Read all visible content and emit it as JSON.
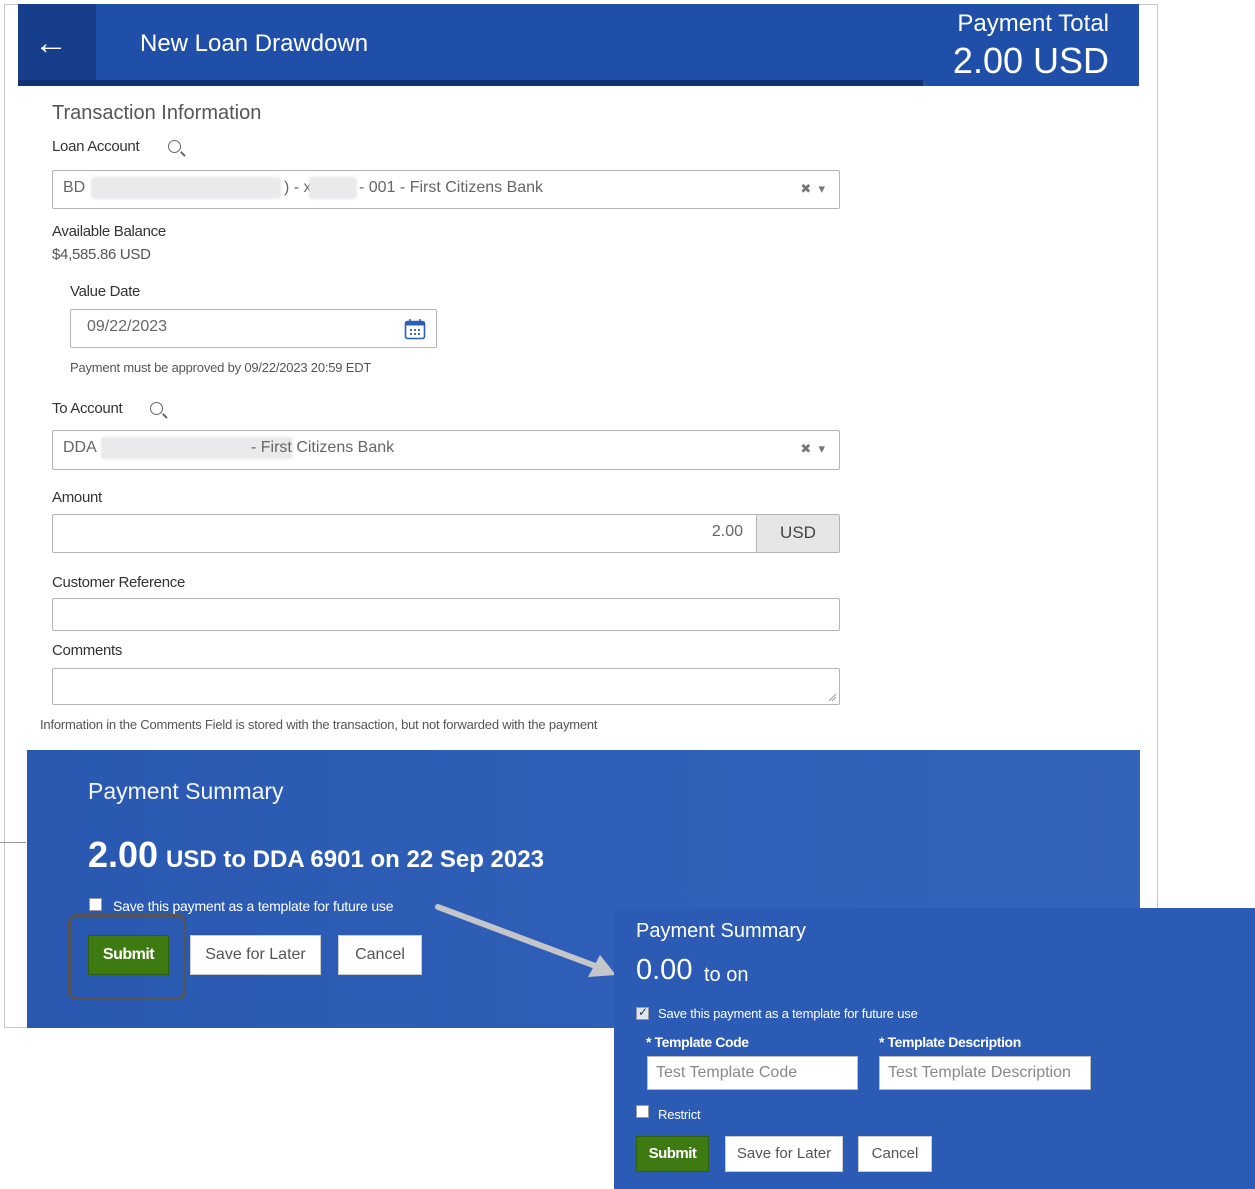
{
  "header": {
    "title": "New Loan Drawdown",
    "payment_total_label": "Payment Total",
    "payment_total_value": "2.00 USD"
  },
  "form": {
    "section_title": "Transaction Information",
    "loan_account": {
      "label": "Loan Account",
      "prefix": "BD",
      "mid": ") - x",
      "suffix": "- 001 - First Citizens Bank"
    },
    "available_balance": {
      "label": "Available Balance",
      "value": "$4,585.86 USD"
    },
    "value_date": {
      "label": "Value Date",
      "value": "09/22/2023",
      "note": "Payment must be approved by 09/22/2023 20:59 EDT"
    },
    "to_account": {
      "label": "To Account",
      "prefix": "DDA",
      "suffix": "- First Citizens Bank"
    },
    "amount": {
      "label": "Amount",
      "value": "2.00",
      "currency": "USD"
    },
    "customer_reference": {
      "label": "Customer Reference",
      "value": ""
    },
    "comments": {
      "label": "Comments",
      "value": "",
      "note": "Information in the Comments Field is stored with the transaction, but not forwarded with the payment"
    }
  },
  "summary": {
    "title": "Payment Summary",
    "amount": "2.00",
    "rest": "USD to DDA 6901 on 22 Sep 2023",
    "save_template_label": "Save this payment as a template for future use",
    "buttons": {
      "submit": "Submit",
      "save_later": "Save for Later",
      "cancel": "Cancel"
    }
  },
  "inset": {
    "title": "Payment Summary",
    "amount": "0.00",
    "rest": "to on",
    "save_template_label": "Save this payment as a template for future use",
    "template_code_label": "* Template Code",
    "template_code_value": "Test Template Code",
    "template_desc_label": "* Template Description",
    "template_desc_value": "Test Template Description",
    "restrict_label": "Restrict",
    "buttons": {
      "submit": "Submit",
      "save_later": "Save for Later",
      "cancel": "Cancel"
    }
  },
  "colors": {
    "header_blue": "#1f4fa8",
    "summary_blue": "#2f5fb8",
    "submit_green": "#3e7a12"
  }
}
